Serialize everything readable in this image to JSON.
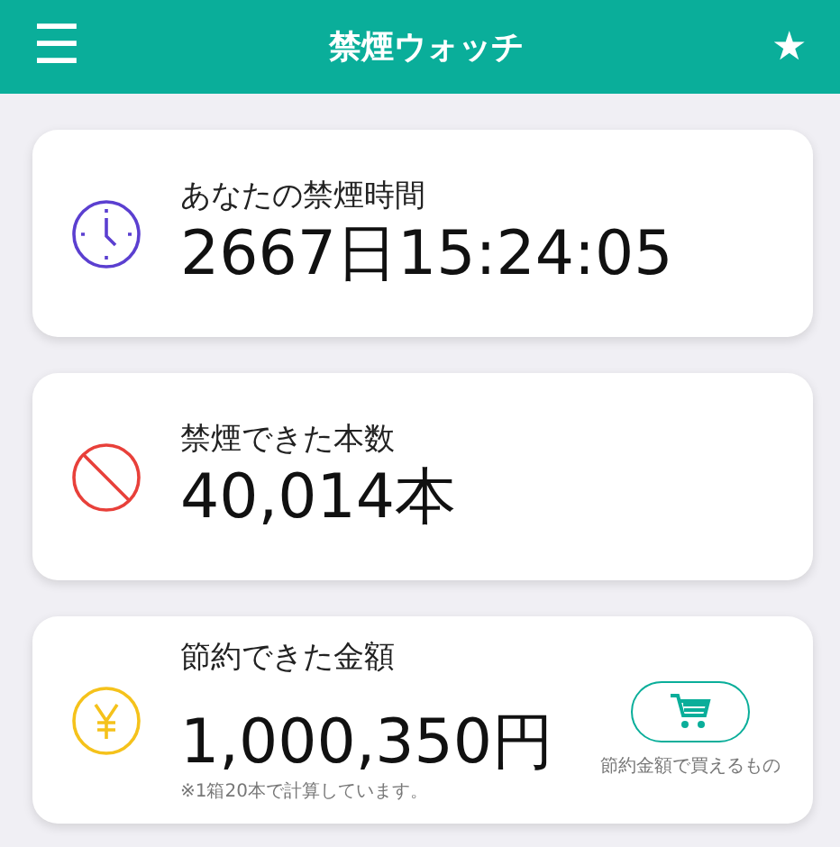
{
  "header": {
    "menu_icon": "☰",
    "title": "禁煙ウォッチ",
    "star_icon": "★"
  },
  "cards": [
    {
      "kind": "time",
      "label": "あなたの禁煙時間",
      "value": "2667日15:24:05"
    },
    {
      "kind": "count",
      "label": "禁煙できた本数",
      "value": "40,014本"
    },
    {
      "kind": "money",
      "label": "節約できた金額",
      "value": "1,000,350円",
      "note": "※1箱20本で計算しています。",
      "action": {
        "caption": "節約金額で買えるもの"
      }
    }
  ]
}
